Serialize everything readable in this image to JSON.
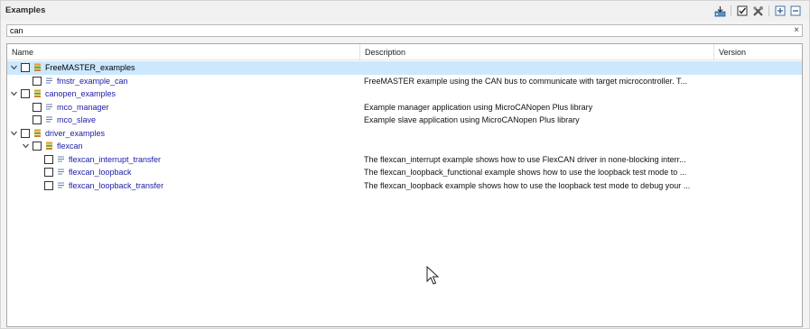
{
  "panel": {
    "title": "Examples",
    "toolbar": [
      {
        "name": "import-icon"
      },
      {
        "name": "checkbox-check-icon"
      },
      {
        "name": "tools-icon"
      },
      {
        "name": "expand-all-icon"
      },
      {
        "name": "collapse-all-icon"
      }
    ]
  },
  "search": {
    "value": "can",
    "clear_label": "×"
  },
  "columns": {
    "name": "Name",
    "description": "Description",
    "version": "Version"
  },
  "rows": [
    {
      "label": "FreeMASTER_examples",
      "description": "",
      "type": "folder",
      "depth": 0,
      "expanded": true,
      "selected": true
    },
    {
      "label": "fmstr_example_can",
      "description": "FreeMASTER example using the CAN bus to communicate with target microcontroller. T...",
      "type": "file",
      "depth": 1,
      "selected": false
    },
    {
      "label": "canopen_examples",
      "description": "",
      "type": "folder",
      "depth": 0,
      "expanded": true,
      "selected": false
    },
    {
      "label": "mco_manager",
      "description": "Example manager application using MicroCANopen Plus library",
      "type": "file",
      "depth": 1,
      "selected": false
    },
    {
      "label": "mco_slave",
      "description": "Example slave application using MicroCANopen Plus library",
      "type": "file",
      "depth": 1,
      "selected": false
    },
    {
      "label": "driver_examples",
      "description": "",
      "type": "folder",
      "depth": 0,
      "expanded": true,
      "selected": false
    },
    {
      "label": "flexcan",
      "description": "",
      "type": "folder",
      "depth": 1,
      "expanded": true,
      "selected": false
    },
    {
      "label": "flexcan_interrupt_transfer",
      "description": "The flexcan_interrupt example shows how to use FlexCAN driver in none-blocking interr...",
      "type": "file",
      "depth": 2,
      "selected": false
    },
    {
      "label": "flexcan_loopback",
      "description": "The flexcan_loopback_functional example shows how to use the loopback test mode to ...",
      "type": "file",
      "depth": 2,
      "selected": false
    },
    {
      "label": "flexcan_loopback_transfer",
      "description": "The flexcan_loopback example shows how to use the loopback test mode to debug your ...",
      "type": "file",
      "depth": 2,
      "selected": false
    }
  ],
  "colors": {
    "selection": "#cce8ff",
    "link_text": "#1a1aa6",
    "folder_icon": "#7aa000"
  }
}
